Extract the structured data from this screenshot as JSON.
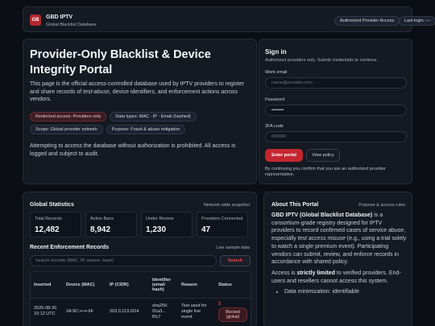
{
  "header": {
    "logo": "GB",
    "brand": "GBD IPTV",
    "subtitle": "Global Blacklist Database",
    "access_pill": "Authorized Provider Access",
    "login_pill": "Last login: —"
  },
  "hero": {
    "title": "Provider-Only Blacklist & Device Integrity Portal",
    "desc_1": "This page is the official access-controlled database used by IPTV providers to register and share records of ",
    "desc_em": "test-abuse",
    "desc_2": ", device identifiers, and enforcement actions across vendors.",
    "tags": [
      "Restricted access: Providers only",
      "Data types: MAC · IP · Email (hashed)",
      "Scope: Global provider network",
      "Purpose: Fraud & abuse mitigation"
    ],
    "warning": "Attempting to access the database without authorization is prohibited. All access is logged and subject to audit."
  },
  "signin": {
    "title": "Sign in",
    "subtitle": "Authorized providers only. Submit credentials to continue.",
    "email_label": "Work email",
    "email_placeholder": "name@provider.com",
    "password_label": "Password",
    "password_value": "••••••••",
    "twofa_label": "2FA code",
    "twofa_placeholder": "000000",
    "enter_label": "Enter portal",
    "policy_label": "View policy",
    "consent": "By continuing you confirm that you are an authorized provider representative."
  },
  "stats": {
    "title": "Global Statistics",
    "note": "Network-wide snapshot",
    "items": [
      {
        "label": "Total Records",
        "value": "12,482"
      },
      {
        "label": "Active Bans",
        "value": "8,942"
      },
      {
        "label": "Under Review",
        "value": "1,230"
      },
      {
        "label": "Providers Connected",
        "value": "47"
      }
    ]
  },
  "recent": {
    "title": "Recent Enforcement Records",
    "note": "Live sample data",
    "search_placeholder": "Search records (MAC, IP, reason, hash)",
    "search_button": "Search",
    "columns": [
      "Inserted",
      "Device (MAC)",
      "IP (CIDR)",
      "Identifier (email hash)",
      "Reason",
      "Status"
    ],
    "rows": [
      {
        "inserted": "2025-08-30 10:12 UTC",
        "mac": "2A:9C:••:••:6F",
        "ip": "203.0.113.0/24",
        "hash": "sha256: 91a3... f0c7",
        "reason": "Test used for single live event",
        "status": "Blocked (global)"
      }
    ]
  },
  "about": {
    "title": "About This Portal",
    "note": "Purpose & access rules",
    "p1_bold": "GBD IPTV (Global Blacklist Database)",
    "p1_a": " is a consortium-grade registry designed for IPTV providers to record confirmed cases of service abuse, especially ",
    "p1_em": "test access misuse",
    "p1_b": " (e.g., using a trial solely to watch a single premium event). Participating vendors can submit, review, and enforce records in accordance with shared policy.",
    "p2_a": "Access is ",
    "p2_bold": "strictly limited",
    "p2_b": " to verified providers. End-users and resellers cannot access this system.",
    "bullet_1": "Data minimization: identifiable"
  }
}
